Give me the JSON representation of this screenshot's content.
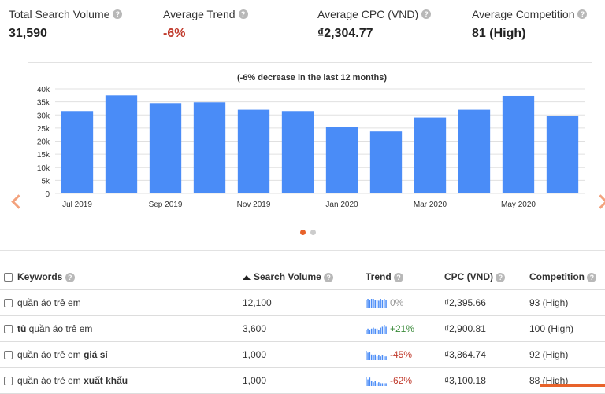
{
  "metrics": [
    {
      "label": "Total Search Volume",
      "value": "31,590",
      "color": "#222222"
    },
    {
      "label": "Average Trend",
      "value": "-6%",
      "color": "#c0392b"
    },
    {
      "label": "Average CPC (VND)",
      "value": "₫2,304.77",
      "color": "#222222"
    },
    {
      "label": "Average Competition",
      "value": "81 (High)",
      "color": "#222222"
    }
  ],
  "chart_data": {
    "type": "bar",
    "title": "(-6% decrease in the last 12 months)",
    "categories": [
      "Jul 2019",
      "Aug 2019",
      "Sep 2019",
      "Oct 2019",
      "Nov 2019",
      "Dec 2019",
      "Jan 2020",
      "Feb 2020",
      "Mar 2020",
      "Apr 2020",
      "May 2020",
      "Jun 2020"
    ],
    "x_tick_labels": [
      "Jul 2019",
      "",
      "Sep 2019",
      "",
      "Nov 2019",
      "",
      "Jan 2020",
      "",
      "Mar 2020",
      "",
      "May 2020",
      ""
    ],
    "values": [
      31500,
      37500,
      34500,
      34800,
      32000,
      31500,
      25300,
      23700,
      29000,
      32000,
      37300,
      29500
    ],
    "y_ticks": [
      "0",
      "5k",
      "10k",
      "15k",
      "20k",
      "25k",
      "30k",
      "35k",
      "40k"
    ],
    "ylim": [
      0,
      40000
    ],
    "bar_color": "#4a8cf7",
    "grid": true
  },
  "carousel": {
    "active": 0,
    "count": 2
  },
  "table": {
    "headers": {
      "keywords": "Keywords",
      "volume": "Search Volume",
      "trend": "Trend",
      "cpc": "CPC (VND)",
      "competition": "Competition"
    },
    "rows": [
      {
        "kw_plain": "quần áo trẻ em",
        "kw_bold": "",
        "kw_prefix_bold": "",
        "volume": "12,100",
        "trend": "0%",
        "trend_dir": "neutral",
        "cpc": "₫2,395.66",
        "competition": "93 (High)",
        "spark": [
          9,
          10,
          9,
          10,
          10,
          9,
          9,
          8,
          10,
          9,
          10,
          9
        ]
      },
      {
        "kw_prefix_bold": "tủ",
        "kw_plain": "quần áo trẻ em",
        "kw_bold": "",
        "volume": "3,600",
        "trend": "+21%",
        "trend_dir": "up",
        "cpc": "₫2,900.81",
        "competition": "100 (High)",
        "spark": [
          5,
          6,
          5,
          6,
          7,
          6,
          6,
          5,
          7,
          8,
          10,
          8
        ]
      },
      {
        "kw_plain": "quần áo trẻ em",
        "kw_bold": "giá sỉ",
        "kw_prefix_bold": "",
        "volume": "1,000",
        "trend": "-45%",
        "trend_dir": "down",
        "cpc": "₫3,864.74",
        "competition": "92 (High)",
        "spark": [
          10,
          8,
          9,
          6,
          5,
          6,
          4,
          5,
          4,
          5,
          4,
          4
        ]
      },
      {
        "kw_plain": "quần áo trẻ em",
        "kw_bold": "xuất khẩu",
        "kw_prefix_bold": "",
        "volume": "1,000",
        "trend": "-62%",
        "trend_dir": "down",
        "cpc": "₫3,100.18",
        "competition": "88 (High)",
        "spark": [
          10,
          7,
          9,
          5,
          4,
          5,
          3,
          4,
          3,
          3,
          3,
          3
        ]
      }
    ]
  }
}
